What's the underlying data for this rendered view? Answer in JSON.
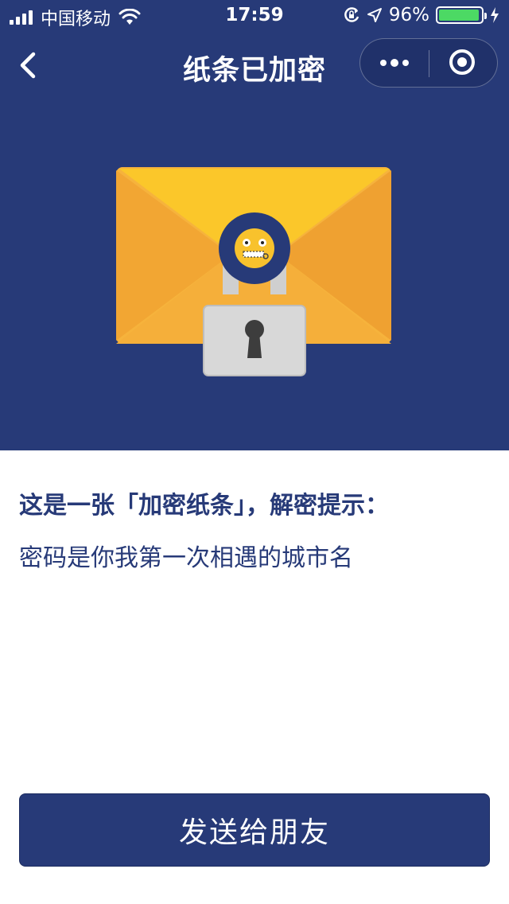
{
  "status_bar": {
    "carrier": "中国移动",
    "time": "17:59",
    "battery": "96%",
    "battery_level": 0.96,
    "icons": [
      "signal-icon",
      "wifi-icon",
      "rotation-lock-icon",
      "location-icon",
      "battery-icon",
      "charging-icon"
    ]
  },
  "navbar": {
    "title": "纸条已加密",
    "back_icon": "chevron-left-icon",
    "more_icon": "more-dots-icon",
    "close_icon": "target-close-icon"
  },
  "hero": {
    "background": "#273a78",
    "illustration": "locked-envelope",
    "icons": [
      "envelope-icon",
      "zipper-mouth-emoji-icon",
      "padlock-icon"
    ]
  },
  "main": {
    "hint_heading": "这是一张「加密纸条」，解密提示：",
    "hint_text": "密码是你我第一次相遇的城市名"
  },
  "footer": {
    "send_button": "发送给朋友"
  },
  "colors": {
    "primary": "#273a78",
    "envelope": "#f6b33c",
    "lock": "#d6d6d6",
    "battery": "#4cd964"
  }
}
